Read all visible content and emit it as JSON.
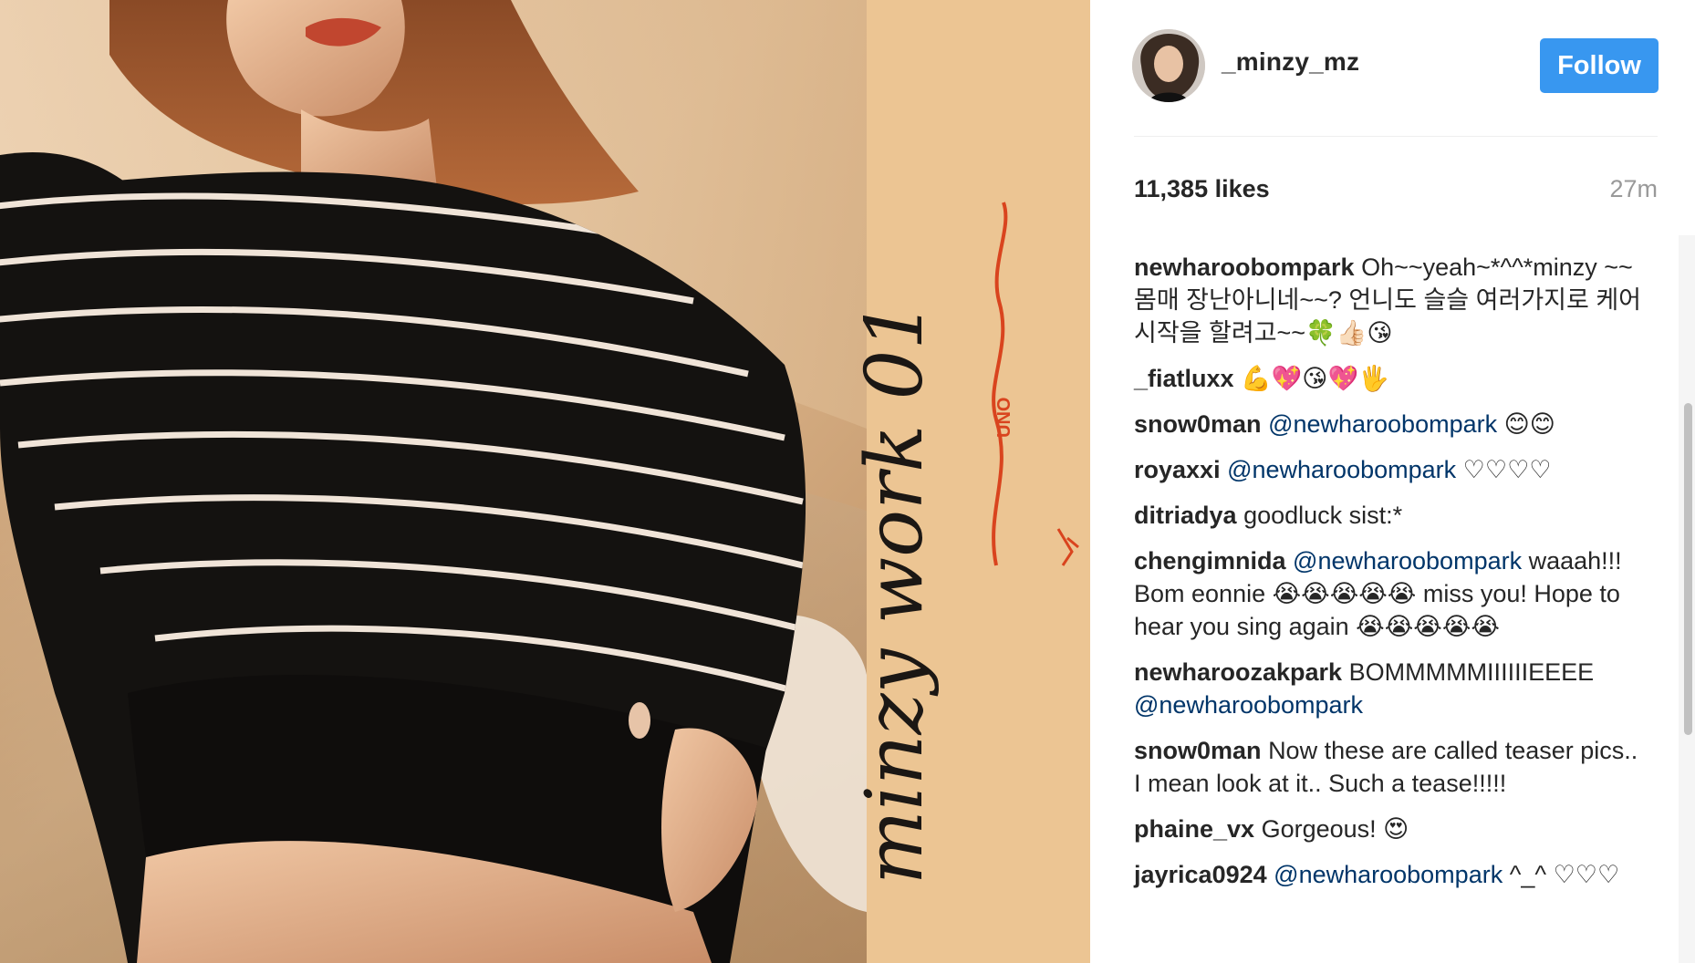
{
  "post": {
    "author": {
      "username": "_minzy_mz"
    },
    "follow_label": "Follow",
    "likes_text": "11,385 likes",
    "time_text": "27m",
    "image": {
      "script_title": "minzy work 01",
      "script_subtitle": "uno",
      "badge_text": "UNO"
    },
    "colors": {
      "follow_bg": "#3897f0",
      "mention": "#003569",
      "background_peach": "#ecc593",
      "stripe_black": "#141210",
      "accent_red": "#d9441e"
    }
  },
  "comments": [
    {
      "user": "newharoobompark",
      "mention": "",
      "text": "Oh~~yeah~*^^*minzy ~~몸매 장난아니네~~? 언니도 슬슬 여러가지로 케어시작을 할려고~~🍀👍🏻😘"
    },
    {
      "user": "_fiatluxx",
      "mention": "",
      "text": "💪💖😘💖🖐"
    },
    {
      "user": "snow0man",
      "mention": "@newharoobompark",
      "text": "😊😊"
    },
    {
      "user": "royaxxi",
      "mention": "@newharoobompark",
      "text": "♡♡♡♡"
    },
    {
      "user": "ditriadya",
      "mention": "",
      "text": "goodluck sist:*"
    },
    {
      "user": "chengimnida",
      "mention": "@newharoobompark",
      "text": "waaah!!! Bom eonnie 😭😭😭😭😭 miss you! Hope to hear you sing again 😭😭😭😭😭"
    },
    {
      "user": "newharoozakpark",
      "mention": "@newharoobompark",
      "text": "BOMMMMMIIIIIIEEEE",
      "mention_after_text": true
    },
    {
      "user": "snow0man",
      "mention": "",
      "text": "Now these are called teaser pics.. I mean look at it.. Such a tease!!!!!"
    },
    {
      "user": "phaine_vx",
      "mention": "",
      "text": "Gorgeous! 😍"
    },
    {
      "user": "jayrica0924",
      "mention": "@newharoobompark",
      "text": "^_^ ♡♡♡"
    }
  ]
}
